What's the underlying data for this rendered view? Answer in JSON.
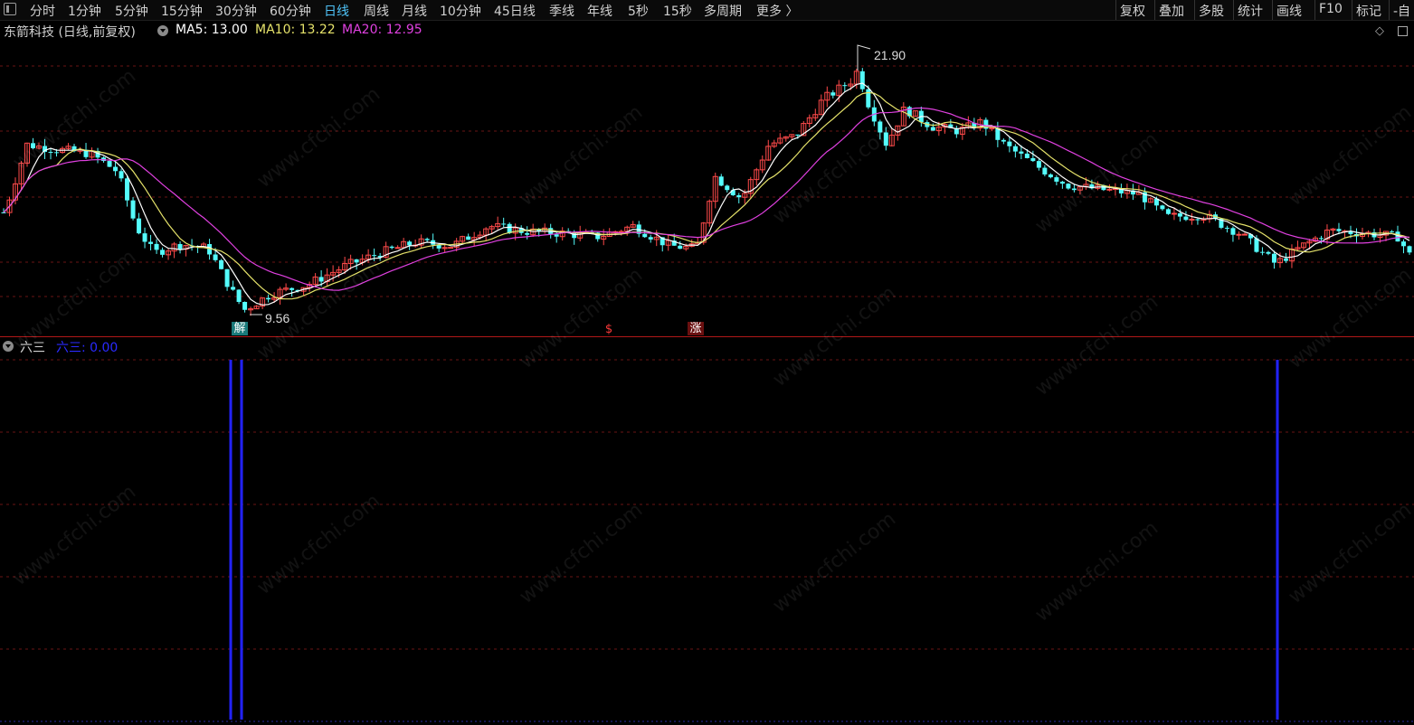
{
  "toolbar": {
    "periods": [
      "分时",
      "1分钟",
      "5分钟",
      "15分钟",
      "30分钟",
      "60分钟",
      "日线",
      "周线",
      "月线",
      "10分钟",
      "45日线",
      "季线",
      "年线",
      "5秒",
      "15秒",
      "多周期",
      "更多 〉"
    ],
    "active_period": "日线",
    "right_buttons": [
      "复权",
      "叠加",
      "多股",
      "统计",
      "画线",
      "F10",
      "标记",
      "-自"
    ]
  },
  "main_chart": {
    "title": "东箭科技 (日线,前复权)",
    "ma5_label": "MA5: 13.00",
    "ma10_label": "MA10: 13.22",
    "ma20_label": "MA20: 12.95",
    "high_label": "21.90",
    "low_label": "9.56",
    "markers": [
      "解",
      "$",
      "涨"
    ],
    "colors": {
      "up": "#ff4a4a",
      "down": "#54fcfc",
      "ma5": "#ffffff",
      "ma10": "#e5e26a",
      "ma20": "#e040e0",
      "grid": "#6a1414"
    }
  },
  "sub_chart": {
    "title": "六三",
    "value_label": "六三: 0.00",
    "bar_color": "#2222ff"
  },
  "watermark": "www.cfchi.com",
  "chart_data": {
    "type": "candlestick",
    "y_high_marked": 21.9,
    "y_low_marked": 9.56,
    "ma_values_last": {
      "MA5": 13.0,
      "MA10": 13.22,
      "MA20": 12.95
    },
    "signal_bars_indices": [
      48,
      49,
      214
    ]
  }
}
